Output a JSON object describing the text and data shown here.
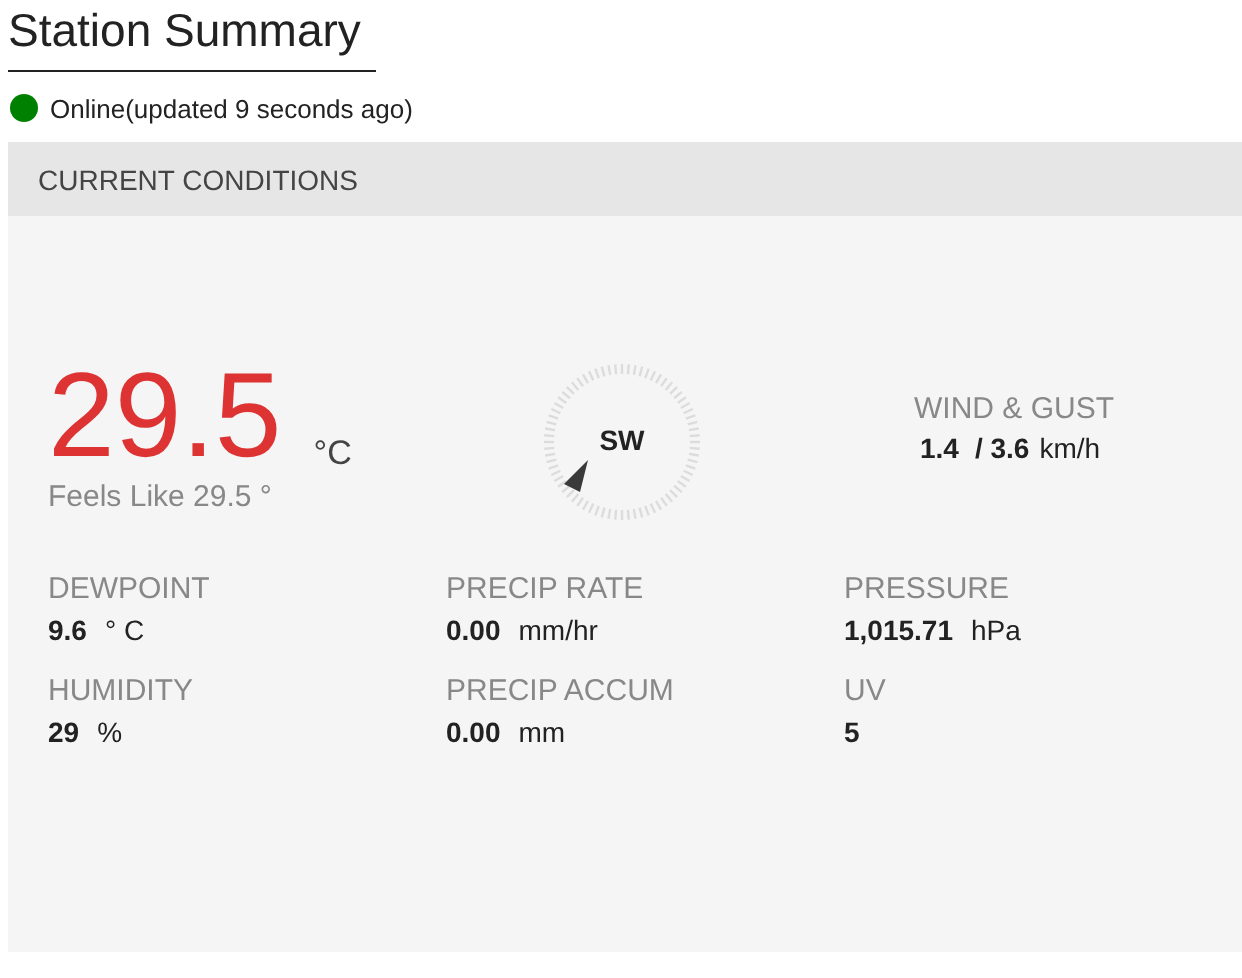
{
  "title": "Station Summary",
  "status": {
    "online": true,
    "text": "Online(updated 9 seconds ago)"
  },
  "panel": {
    "heading": "CURRENT CONDITIONS",
    "temperature": {
      "value": "29.5",
      "unit": "°C",
      "feels_like": "Feels Like 29.5 °"
    },
    "wind": {
      "direction": "SW",
      "label": "WIND & GUST",
      "speed": "1.4",
      "gust": "/ 3.6",
      "unit": "km/h"
    },
    "stats": [
      {
        "label": "DEWPOINT",
        "value": "9.6",
        "unit": "° C"
      },
      {
        "label": "PRECIP RATE",
        "value": "0.00",
        "unit": "mm/hr"
      },
      {
        "label": "PRESSURE",
        "value": "1,015.71",
        "unit": "hPa"
      },
      {
        "label": "HUMIDITY",
        "value": "29",
        "unit": "%"
      },
      {
        "label": "PRECIP ACCUM",
        "value": "0.00",
        "unit": "mm"
      },
      {
        "label": "UV",
        "value": "5"
      }
    ]
  }
}
